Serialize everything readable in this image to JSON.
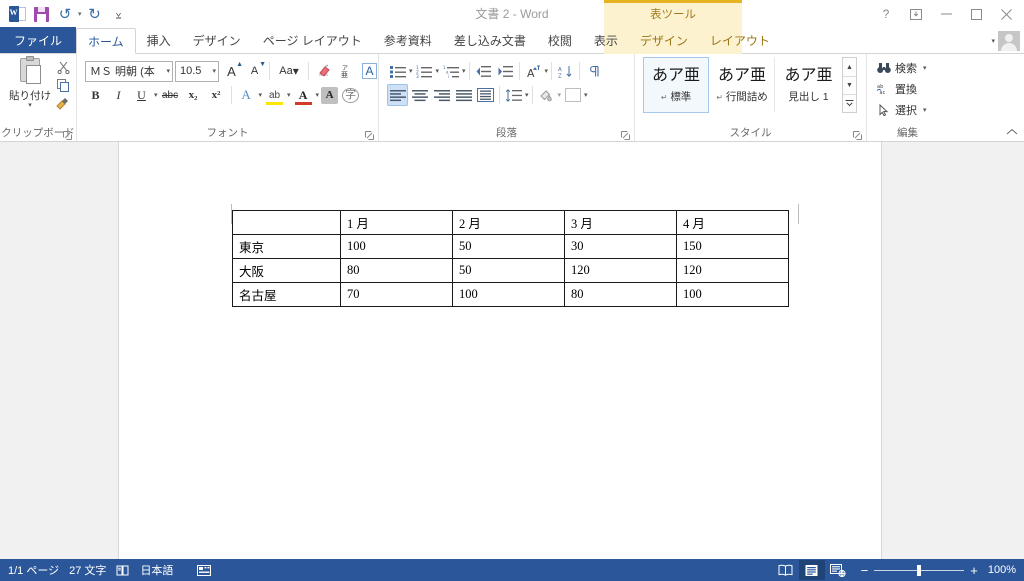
{
  "titlebar": {
    "document_title": "文書 2 - Word",
    "quick_access": [
      {
        "name": "word-logo-icon",
        "label": "W"
      },
      {
        "name": "save-icon",
        "label": "保存"
      },
      {
        "name": "undo-icon",
        "label": "↺"
      },
      {
        "name": "redo-icon",
        "label": "↻"
      },
      {
        "name": "customize-qat-icon",
        "label": "▾"
      }
    ],
    "window_controls": [
      {
        "name": "help-button",
        "label": "?"
      },
      {
        "name": "ribbon-display-options-button",
        "label": "⬓"
      },
      {
        "name": "minimize-button",
        "label": "—"
      },
      {
        "name": "maximize-button",
        "label": "❐"
      },
      {
        "name": "close-button",
        "label": "✕"
      }
    ],
    "contextual_tool_title": "表ツール"
  },
  "tabs": {
    "file": "ファイル",
    "items": [
      {
        "label": "ホーム",
        "active": true
      },
      {
        "label": "挿入",
        "active": false
      },
      {
        "label": "デザイン",
        "active": false
      },
      {
        "label": "ページ レイアウト",
        "active": false
      },
      {
        "label": "参考資料",
        "active": false
      },
      {
        "label": "差し込み文書",
        "active": false
      },
      {
        "label": "校閲",
        "active": false
      },
      {
        "label": "表示",
        "active": false
      }
    ],
    "contextual": [
      {
        "label": "デザイン"
      },
      {
        "label": "レイアウト"
      }
    ],
    "account_caret": "▾"
  },
  "ribbon": {
    "clipboard": {
      "group_label": "クリップボード",
      "paste_label": "貼り付け",
      "paste_caret": "▾",
      "cut_label": "切り取り",
      "copy_label": "コピー",
      "format_painter_label": "書式のコピー/貼り付け",
      "dialog_launcher": "⌐"
    },
    "font": {
      "group_label": "フォント",
      "font_name": "ＭＳ 明朝 (本",
      "font_size": "10.5",
      "grow_font": "A",
      "shrink_font": "A",
      "change_case": "Aa",
      "clear_formatting": "✎",
      "phonetic_guide": "ア",
      "enclose_characters": "A",
      "bold": "B",
      "italic": "I",
      "underline": "U",
      "strikethrough": "abc",
      "subscript": "x₂",
      "superscript": "x²",
      "text_effects": "A",
      "highlight": "ab",
      "font_color": "A",
      "char_shading": "A",
      "char_border": "字",
      "dialog_launcher": "⌐"
    },
    "paragraph": {
      "group_label": "段落",
      "bullets": "箇条書き",
      "numbering": "段落番号",
      "multilevel": "アウトライン",
      "decrease_indent": "インデントを減らす",
      "increase_indent": "インデントを増やす",
      "asian_layout": "拡張書式",
      "sort": "並べ替え",
      "show_marks": "編集記号の表示/非表示",
      "align_left": "左揃え",
      "align_center": "中央揃え",
      "align_right": "右揃え",
      "justify": "両端揃え",
      "distribute": "均等割り付け",
      "line_spacing": "行と段落の間隔",
      "shading": "塗りつぶし",
      "borders": "罫線",
      "dialog_launcher": "⌐"
    },
    "styles": {
      "group_label": "スタイル",
      "gallery": [
        {
          "preview": "あア亜",
          "name": "標準",
          "pilcrow": "↵",
          "selected": true
        },
        {
          "preview": "あア亜",
          "name": "行間詰め",
          "pilcrow": "↵",
          "selected": false
        },
        {
          "preview": "あア亜",
          "name": "見出し 1",
          "pilcrow": "",
          "selected": false
        }
      ],
      "scroll_up": "▲",
      "scroll_down": "▼",
      "more": "▾",
      "dialog_launcher": "⌐"
    },
    "editing": {
      "group_label": "編集",
      "find": "検索",
      "find_caret": "▾",
      "replace": "置換",
      "select": "選択",
      "select_caret": "▾"
    },
    "collapse_ribbon": "⌃"
  },
  "document": {
    "table": {
      "headers": [
        "",
        "1 月",
        "2 月",
        "3 月",
        "4 月"
      ],
      "rows": [
        [
          "東京",
          "100",
          "50",
          "30",
          "150"
        ],
        [
          "大阪",
          "80",
          "50",
          "120",
          "120"
        ],
        [
          "名古屋",
          "70",
          "100",
          "80",
          "100"
        ]
      ]
    }
  },
  "statusbar": {
    "page_label": "1/1 ページ",
    "word_count": "27 文字",
    "proofing_icon": "校正",
    "language": "日本語",
    "macro_icon": "マクロの記録",
    "views": [
      {
        "name": "read-mode-view-button",
        "glyph": "▤",
        "active": false
      },
      {
        "name": "print-layout-view-button",
        "glyph": "▥",
        "active": true
      },
      {
        "name": "web-layout-view-button",
        "glyph": "▦",
        "active": false
      }
    ],
    "zoom_out": "−",
    "zoom_in": "+",
    "zoom_value": "100%"
  },
  "colors": {
    "word_blue": "#2b579a",
    "contextual_yellow": "#e6b422",
    "contextual_band": "#fdf2d0",
    "workspace_gray": "#f1f1f1",
    "selected_style_border": "#a6c8ea"
  }
}
